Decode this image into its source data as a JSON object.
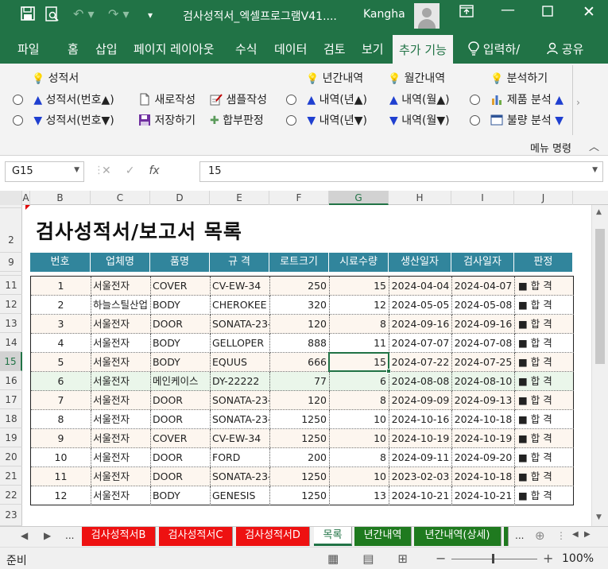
{
  "window": {
    "title": "검사성적서_엑셀프로그램V41....",
    "user": "Kangha"
  },
  "tabs": [
    "파일",
    "홈",
    "삽입",
    "페이지 레이아웃",
    "수식",
    "데이터",
    "검토",
    "보기",
    "추가 기능"
  ],
  "active_tab": "추가 기능",
  "tell_me": "입력하/",
  "share": "공유",
  "ribbon": {
    "g1_header": "성적서",
    "g1_up": "성적서(번호▲)",
    "g1_down": "성적서(번호▼)",
    "new": "새로작성",
    "sample": "샘플작성",
    "save": "저장하기",
    "judge": "합부판정",
    "g2_header": "년간내역",
    "g2_up": "내역(년▲)",
    "g2_down": "내역(년▼)",
    "g3_header": "월간내역",
    "g3_up": "내역(월▲)",
    "g3_down": "내역(월▼)",
    "g4_header": "분석하기",
    "product": "제품 분석",
    "defect": "불량 분석",
    "menu_name": "메뉴 명령"
  },
  "formula": {
    "namebox": "G15",
    "value": "15"
  },
  "columns": [
    "A",
    "B",
    "C",
    "D",
    "E",
    "F",
    "G",
    "H",
    "I",
    "J"
  ],
  "selected_col": "G",
  "row_numbers": [
    "1",
    "2",
    "9",
    "11",
    "12",
    "13",
    "14",
    "15",
    "16",
    "17",
    "18",
    "19",
    "20",
    "21",
    "22",
    "23"
  ],
  "selected_row": "15",
  "sheet_title": "검사성적서/보고서 목록",
  "table": {
    "headers": [
      "번호",
      "업체명",
      "품명",
      "규  격",
      "로트크기",
      "시료수량",
      "생산일자",
      "검사일자",
      "판정"
    ],
    "rows": [
      [
        "1",
        "서울전자",
        "COVER",
        "CV-EW-34",
        "250",
        "15",
        "2024-04-04",
        "2024-04-07",
        "■ 합 격"
      ],
      [
        "2",
        "하늘스틸산업",
        "BODY",
        "CHEROKEE",
        "320",
        "12",
        "2024-05-05",
        "2024-05-08",
        "■ 합 격"
      ],
      [
        "3",
        "서울전자",
        "DOOR",
        "SONATA-23-",
        "120",
        "8",
        "2024-09-16",
        "2024-09-16",
        "■ 합 격"
      ],
      [
        "4",
        "서울전자",
        "BODY",
        "GELLOPER",
        "888",
        "11",
        "2024-07-07",
        "2024-07-08",
        "■ 합 격"
      ],
      [
        "5",
        "서울전자",
        "BODY",
        "EQUUS",
        "666",
        "15",
        "2024-07-22",
        "2024-07-25",
        "■ 합 격"
      ],
      [
        "6",
        "서울전자",
        "메인케이스",
        "DY-22222",
        "77",
        "6",
        "2024-08-08",
        "2024-08-10",
        "■ 합 격"
      ],
      [
        "7",
        "서울전자",
        "DOOR",
        "SONATA-23-",
        "120",
        "8",
        "2024-09-09",
        "2024-09-13",
        "■ 합 격"
      ],
      [
        "8",
        "서울전자",
        "DOOR",
        "SONATA-23-",
        "1250",
        "10",
        "2024-10-16",
        "2024-10-18",
        "■ 합 격"
      ],
      [
        "9",
        "서울전자",
        "COVER",
        "CV-EW-34",
        "1250",
        "10",
        "2024-10-19",
        "2024-10-19",
        "■ 합 격"
      ],
      [
        "10",
        "서울전자",
        "DOOR",
        "FORD",
        "200",
        "8",
        "2024-09-11",
        "2024-09-20",
        "■ 합 격"
      ],
      [
        "11",
        "서울전자",
        "DOOR",
        "SONATA-23-",
        "1250",
        "10",
        "2023-02-03",
        "2024-10-18",
        "■ 합 격"
      ],
      [
        "12",
        "서울전자",
        "BODY",
        "GENESIS",
        "1250",
        "13",
        "2024-10-21",
        "2024-10-21",
        "■ 합 격"
      ]
    ]
  },
  "sheet_tabs": [
    {
      "label": "검사성적서B",
      "color": "#ee1111"
    },
    {
      "label": "검사성적서C",
      "color": "#ee1111"
    },
    {
      "label": "검사성적서D",
      "color": "#ee1111"
    },
    {
      "label": "목록",
      "color": "#ffffff"
    },
    {
      "label": "년간내역",
      "color": "#1f7a1f"
    },
    {
      "label": "년간내역(상세)",
      "color": "#1f7a1f"
    }
  ],
  "active_sheet": "목록",
  "status": {
    "ready": "준비",
    "zoom": "100%"
  },
  "colors": {
    "accent": "#217346",
    "header_fill": "#31859c",
    "selected_row_fill": "#eaf6ea",
    "odd_row_fill": "#fdf6ef"
  }
}
